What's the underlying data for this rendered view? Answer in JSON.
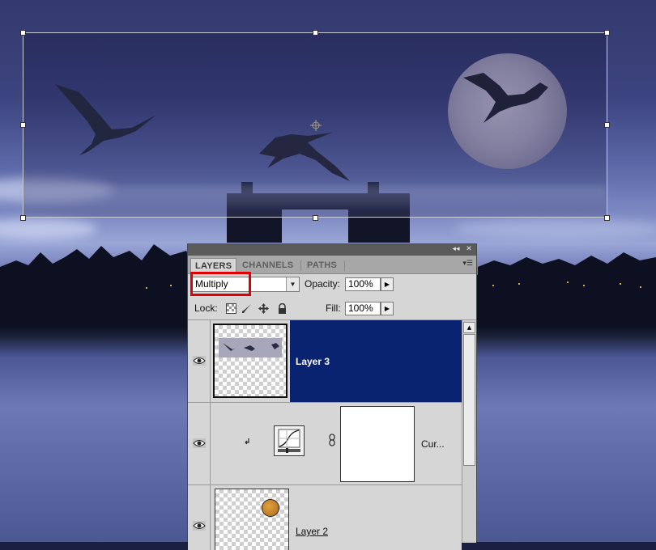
{
  "panel": {
    "tabs": [
      {
        "label": "LAYERS",
        "active": true
      },
      {
        "label": "CHANNELS",
        "active": false
      },
      {
        "label": "PATHS",
        "active": false
      }
    ],
    "collapse_icon": "double-chevron-left-icon",
    "close_icon": "close-icon",
    "menu_icon": "panel-menu-icon",
    "blend_mode": "Multiply",
    "opacity_label": "Opacity:",
    "opacity_value": "100%",
    "lock_label": "Lock:",
    "fill_label": "Fill:",
    "fill_value": "100%"
  },
  "layers": [
    {
      "name": "Layer 3",
      "selected": true,
      "visible": true
    },
    {
      "name": "Cur...",
      "selected": false,
      "visible": true,
      "type": "curves-adjustment"
    },
    {
      "name": "Layer 2",
      "selected": false,
      "visible": true
    }
  ],
  "colors": {
    "selected_row": "#0a2370",
    "highlight_box": "#e00000",
    "panel_bg": "#d6d6d6"
  }
}
